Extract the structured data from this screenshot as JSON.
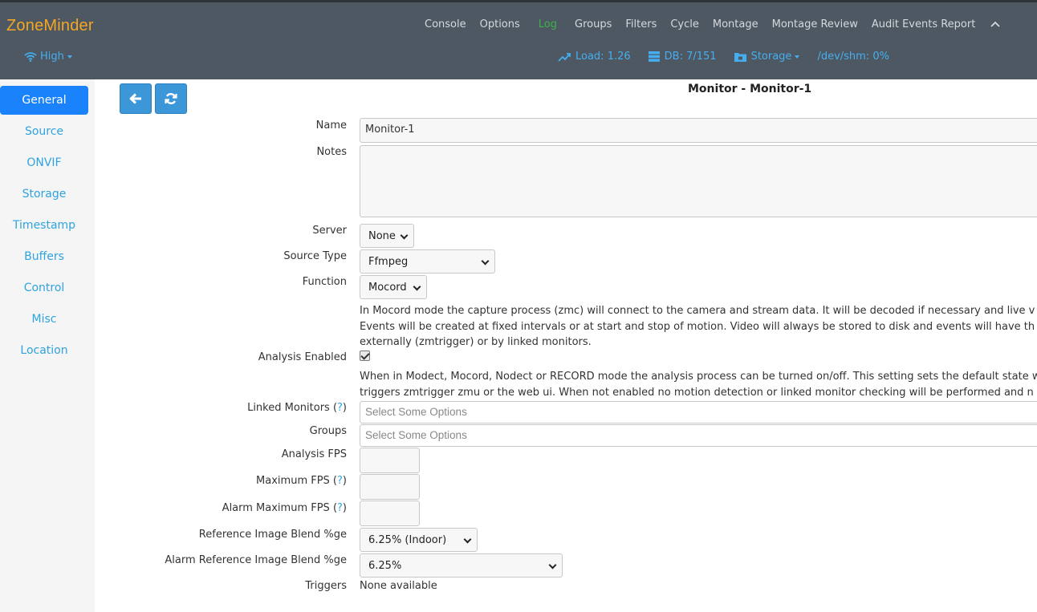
{
  "header": {
    "brand": "ZoneMinder",
    "nav": [
      "Console",
      "Options",
      "Log",
      "Groups",
      "Filters",
      "Cycle",
      "Montage",
      "Montage Review",
      "Audit Events Report"
    ],
    "bandwidth": "High",
    "load": "Load: 1.26",
    "db": "DB: 7/151",
    "storage": "Storage",
    "shm": "/dev/shm: 0%",
    "colors": {
      "brand": "#f5a623",
      "log": "#3cb24a",
      "status": "#46aef0",
      "bar": "#4d5862"
    }
  },
  "sidebar": {
    "items": [
      "General",
      "Source",
      "ONVIF",
      "Storage",
      "Timestamp",
      "Buffers",
      "Control",
      "Misc",
      "Location"
    ],
    "active": "General"
  },
  "toolbar": {
    "back_icon": "arrow-left-icon",
    "refresh_icon": "refresh-icon"
  },
  "page": {
    "title": "Monitor - Monitor-1"
  },
  "form": {
    "name_label": "Name",
    "name_value": "Monitor-1",
    "notes_label": "Notes",
    "server_label": "Server",
    "server_value": "None",
    "source_type_label": "Source Type",
    "source_type_value": "Ffmpeg",
    "function_label": "Function",
    "function_value": "Mocord",
    "function_help": [
      "In Mocord mode the capture process (zmc) will connect to the camera and stream data. It will be decoded if necessary and live v",
      "Events will be created at fixed intervals or at start and stop of motion. Video will always be stored to disk and events will have th",
      "externally (zmtrigger) or by linked monitors."
    ],
    "analysis_enabled_label": "Analysis Enabled",
    "analysis_help": [
      "When in Modect, Mocord, Nodect or RECORD mode the analysis process can be turned on/off. This setting sets the default state w",
      "triggers zmtrigger zmu or the web ui. When not enabled no motion detection or linked monitor checking will be performed and n"
    ],
    "linked_monitors_label": "Linked Monitors (",
    "help_mark": "?",
    "close_paren": ")",
    "linked_monitors_placeholder": "Select Some Options",
    "groups_label": "Groups",
    "groups_placeholder": "Select Some Options",
    "analysis_fps_label": "Analysis FPS",
    "maximum_fps_label": "Maximum FPS (",
    "alarm_maximum_fps_label": "Alarm Maximum FPS (",
    "ref_blend_label": "Reference Image Blend %ge",
    "ref_blend_value": "6.25% (Indoor)",
    "alarm_ref_blend_label": "Alarm Reference Image Blend %ge",
    "alarm_ref_blend_value": "6.25%",
    "triggers_label": "Triggers",
    "triggers_value": "None available"
  }
}
